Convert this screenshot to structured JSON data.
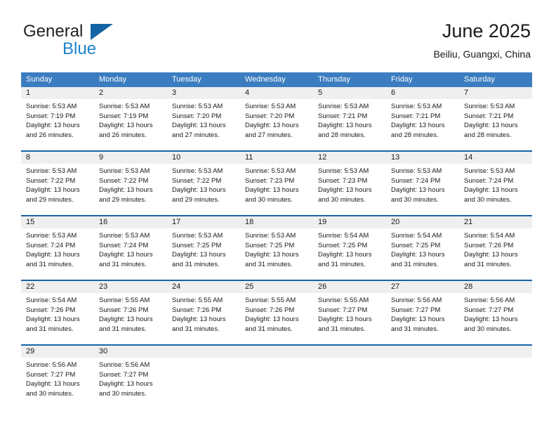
{
  "brand": {
    "name_top": "General",
    "name_bottom": "Blue",
    "flag_icon": "triangle-flag-icon",
    "colors": {
      "general_text": "#231f20",
      "blue_text": "#1b84cd",
      "flag": "#1464a5"
    }
  },
  "header": {
    "title": "June 2025",
    "subtitle": "Beiliu, Guangxi, China"
  },
  "calendar": {
    "header_bg": "#3b7dc0",
    "week_divider": "#1964a8",
    "daynum_bg": "#efefef",
    "weekdays": [
      "Sunday",
      "Monday",
      "Tuesday",
      "Wednesday",
      "Thursday",
      "Friday",
      "Saturday"
    ],
    "weeks": [
      [
        {
          "day": "1",
          "sunrise": "Sunrise: 5:53 AM",
          "sunset": "Sunset: 7:19 PM",
          "daylight_1": "Daylight: 13 hours",
          "daylight_2": "and 26 minutes."
        },
        {
          "day": "2",
          "sunrise": "Sunrise: 5:53 AM",
          "sunset": "Sunset: 7:19 PM",
          "daylight_1": "Daylight: 13 hours",
          "daylight_2": "and 26 minutes."
        },
        {
          "day": "3",
          "sunrise": "Sunrise: 5:53 AM",
          "sunset": "Sunset: 7:20 PM",
          "daylight_1": "Daylight: 13 hours",
          "daylight_2": "and 27 minutes."
        },
        {
          "day": "4",
          "sunrise": "Sunrise: 5:53 AM",
          "sunset": "Sunset: 7:20 PM",
          "daylight_1": "Daylight: 13 hours",
          "daylight_2": "and 27 minutes."
        },
        {
          "day": "5",
          "sunrise": "Sunrise: 5:53 AM",
          "sunset": "Sunset: 7:21 PM",
          "daylight_1": "Daylight: 13 hours",
          "daylight_2": "and 28 minutes."
        },
        {
          "day": "6",
          "sunrise": "Sunrise: 5:53 AM",
          "sunset": "Sunset: 7:21 PM",
          "daylight_1": "Daylight: 13 hours",
          "daylight_2": "and 28 minutes."
        },
        {
          "day": "7",
          "sunrise": "Sunrise: 5:53 AM",
          "sunset": "Sunset: 7:21 PM",
          "daylight_1": "Daylight: 13 hours",
          "daylight_2": "and 28 minutes."
        }
      ],
      [
        {
          "day": "8",
          "sunrise": "Sunrise: 5:53 AM",
          "sunset": "Sunset: 7:22 PM",
          "daylight_1": "Daylight: 13 hours",
          "daylight_2": "and 29 minutes."
        },
        {
          "day": "9",
          "sunrise": "Sunrise: 5:53 AM",
          "sunset": "Sunset: 7:22 PM",
          "daylight_1": "Daylight: 13 hours",
          "daylight_2": "and 29 minutes."
        },
        {
          "day": "10",
          "sunrise": "Sunrise: 5:53 AM",
          "sunset": "Sunset: 7:22 PM",
          "daylight_1": "Daylight: 13 hours",
          "daylight_2": "and 29 minutes."
        },
        {
          "day": "11",
          "sunrise": "Sunrise: 5:53 AM",
          "sunset": "Sunset: 7:23 PM",
          "daylight_1": "Daylight: 13 hours",
          "daylight_2": "and 30 minutes."
        },
        {
          "day": "12",
          "sunrise": "Sunrise: 5:53 AM",
          "sunset": "Sunset: 7:23 PM",
          "daylight_1": "Daylight: 13 hours",
          "daylight_2": "and 30 minutes."
        },
        {
          "day": "13",
          "sunrise": "Sunrise: 5:53 AM",
          "sunset": "Sunset: 7:24 PM",
          "daylight_1": "Daylight: 13 hours",
          "daylight_2": "and 30 minutes."
        },
        {
          "day": "14",
          "sunrise": "Sunrise: 5:53 AM",
          "sunset": "Sunset: 7:24 PM",
          "daylight_1": "Daylight: 13 hours",
          "daylight_2": "and 30 minutes."
        }
      ],
      [
        {
          "day": "15",
          "sunrise": "Sunrise: 5:53 AM",
          "sunset": "Sunset: 7:24 PM",
          "daylight_1": "Daylight: 13 hours",
          "daylight_2": "and 31 minutes."
        },
        {
          "day": "16",
          "sunrise": "Sunrise: 5:53 AM",
          "sunset": "Sunset: 7:24 PM",
          "daylight_1": "Daylight: 13 hours",
          "daylight_2": "and 31 minutes."
        },
        {
          "day": "17",
          "sunrise": "Sunrise: 5:53 AM",
          "sunset": "Sunset: 7:25 PM",
          "daylight_1": "Daylight: 13 hours",
          "daylight_2": "and 31 minutes."
        },
        {
          "day": "18",
          "sunrise": "Sunrise: 5:53 AM",
          "sunset": "Sunset: 7:25 PM",
          "daylight_1": "Daylight: 13 hours",
          "daylight_2": "and 31 minutes."
        },
        {
          "day": "19",
          "sunrise": "Sunrise: 5:54 AM",
          "sunset": "Sunset: 7:25 PM",
          "daylight_1": "Daylight: 13 hours",
          "daylight_2": "and 31 minutes."
        },
        {
          "day": "20",
          "sunrise": "Sunrise: 5:54 AM",
          "sunset": "Sunset: 7:25 PM",
          "daylight_1": "Daylight: 13 hours",
          "daylight_2": "and 31 minutes."
        },
        {
          "day": "21",
          "sunrise": "Sunrise: 5:54 AM",
          "sunset": "Sunset: 7:26 PM",
          "daylight_1": "Daylight: 13 hours",
          "daylight_2": "and 31 minutes."
        }
      ],
      [
        {
          "day": "22",
          "sunrise": "Sunrise: 5:54 AM",
          "sunset": "Sunset: 7:26 PM",
          "daylight_1": "Daylight: 13 hours",
          "daylight_2": "and 31 minutes."
        },
        {
          "day": "23",
          "sunrise": "Sunrise: 5:55 AM",
          "sunset": "Sunset: 7:26 PM",
          "daylight_1": "Daylight: 13 hours",
          "daylight_2": "and 31 minutes."
        },
        {
          "day": "24",
          "sunrise": "Sunrise: 5:55 AM",
          "sunset": "Sunset: 7:26 PM",
          "daylight_1": "Daylight: 13 hours",
          "daylight_2": "and 31 minutes."
        },
        {
          "day": "25",
          "sunrise": "Sunrise: 5:55 AM",
          "sunset": "Sunset: 7:26 PM",
          "daylight_1": "Daylight: 13 hours",
          "daylight_2": "and 31 minutes."
        },
        {
          "day": "26",
          "sunrise": "Sunrise: 5:55 AM",
          "sunset": "Sunset: 7:27 PM",
          "daylight_1": "Daylight: 13 hours",
          "daylight_2": "and 31 minutes."
        },
        {
          "day": "27",
          "sunrise": "Sunrise: 5:56 AM",
          "sunset": "Sunset: 7:27 PM",
          "daylight_1": "Daylight: 13 hours",
          "daylight_2": "and 31 minutes."
        },
        {
          "day": "28",
          "sunrise": "Sunrise: 5:56 AM",
          "sunset": "Sunset: 7:27 PM",
          "daylight_1": "Daylight: 13 hours",
          "daylight_2": "and 30 minutes."
        }
      ],
      [
        {
          "day": "29",
          "sunrise": "Sunrise: 5:56 AM",
          "sunset": "Sunset: 7:27 PM",
          "daylight_1": "Daylight: 13 hours",
          "daylight_2": "and 30 minutes."
        },
        {
          "day": "30",
          "sunrise": "Sunrise: 5:56 AM",
          "sunset": "Sunset: 7:27 PM",
          "daylight_1": "Daylight: 13 hours",
          "daylight_2": "and 30 minutes."
        },
        {
          "day": "",
          "sunrise": "",
          "sunset": "",
          "daylight_1": "",
          "daylight_2": ""
        },
        {
          "day": "",
          "sunrise": "",
          "sunset": "",
          "daylight_1": "",
          "daylight_2": ""
        },
        {
          "day": "",
          "sunrise": "",
          "sunset": "",
          "daylight_1": "",
          "daylight_2": ""
        },
        {
          "day": "",
          "sunrise": "",
          "sunset": "",
          "daylight_1": "",
          "daylight_2": ""
        },
        {
          "day": "",
          "sunrise": "",
          "sunset": "",
          "daylight_1": "",
          "daylight_2": ""
        }
      ]
    ]
  }
}
